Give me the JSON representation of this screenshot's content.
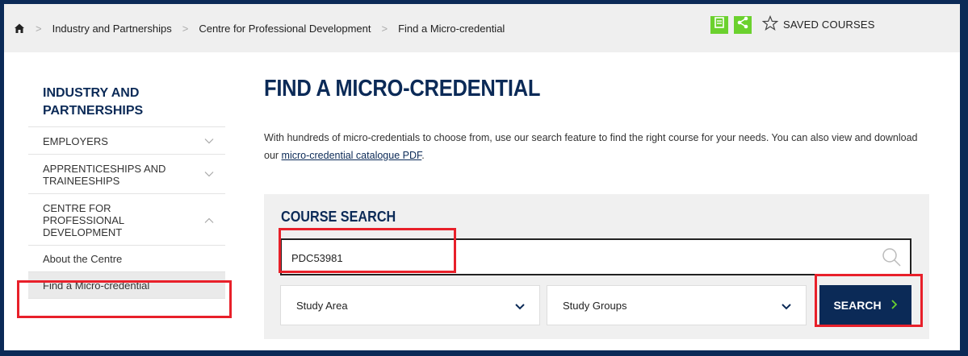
{
  "breadcrumb": {
    "items": [
      "Industry and Partnerships",
      "Centre for Professional Development",
      "Find a Micro-credential"
    ]
  },
  "toolbar": {
    "saved_label": "SAVED COURSES",
    "accent": "#6bd12e"
  },
  "sidebar": {
    "title": "INDUSTRY AND PARTNERSHIPS",
    "items": [
      {
        "label": "EMPLOYERS",
        "expanded": false
      },
      {
        "label": "APPRENTICESHIPS AND TRAINEESHIPS",
        "expanded": false
      },
      {
        "label": "CENTRE FOR PROFESSIONAL DEVELOPMENT",
        "expanded": true
      }
    ],
    "subitems": [
      {
        "label": "About the Centre"
      },
      {
        "label": "Find a Micro-credential",
        "active": true
      }
    ]
  },
  "main": {
    "title": "FIND A MICRO-CREDENTIAL",
    "intro_text": "With hundreds of micro-credentials to choose from, use our search feature to find the right course for your needs. You can also view and download our ",
    "intro_link": "micro-credential catalogue PDF",
    "intro_end": "."
  },
  "search": {
    "title": "COURSE SEARCH",
    "value": "PDC53981",
    "study_area": "Study Area",
    "study_groups": "Study Groups",
    "button_label": "SEARCH"
  },
  "colors": {
    "brand_navy": "#0b2a57",
    "highlight_red": "#e8202a"
  }
}
